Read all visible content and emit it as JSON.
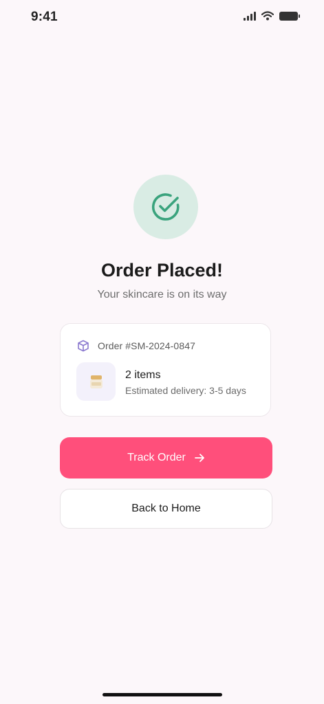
{
  "status_bar": {
    "time": "9:41",
    "icons": [
      "signal-icon",
      "wifi-icon",
      "battery-icon"
    ]
  },
  "confirmation": {
    "icon": "check-circle-icon",
    "title": "Order Placed!",
    "subtitle": "Your skincare is on its way"
  },
  "order": {
    "icon": "package-icon",
    "number": "Order #SM-2024-0847",
    "items_count": "2 items",
    "delivery": "Estimated delivery: 3-5 days",
    "thumbnail": "cream-jar-icon"
  },
  "actions": {
    "track_label": "Track Order",
    "track_icon": "arrow-right-icon",
    "home_label": "Back to Home"
  },
  "colors": {
    "background": "#fcf7fa",
    "accent": "#ff4f7b",
    "success": "#3aa37d",
    "success_bg": "#d9ece4",
    "package": "#8a78cf"
  }
}
